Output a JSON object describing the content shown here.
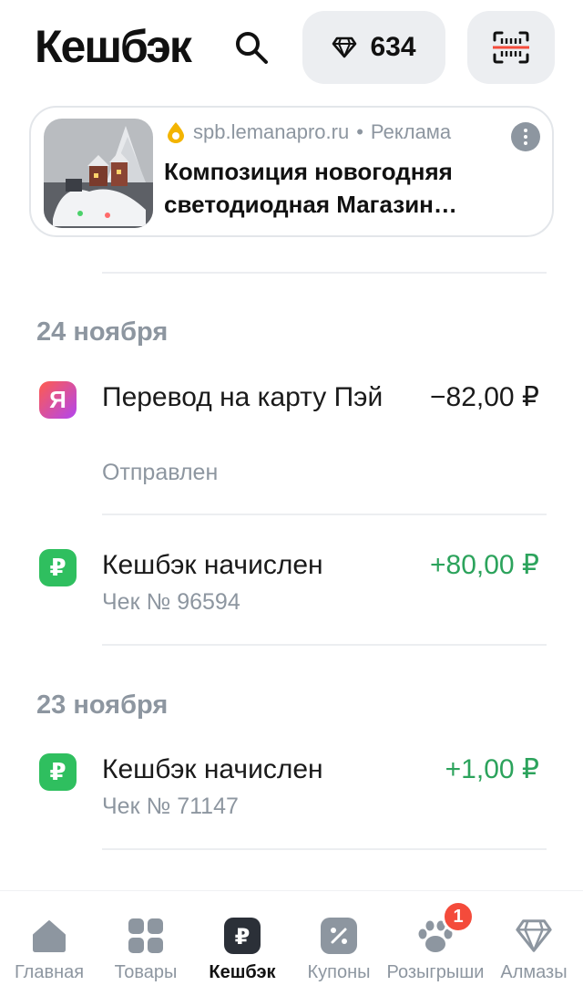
{
  "header": {
    "title": "Кешбэк",
    "diamonds_count": "634"
  },
  "ad": {
    "source": "spb.lemanapro.ru",
    "separator": "•",
    "label": "Реклама",
    "title": "Композиция новогодняя светодиодная Магазин…"
  },
  "groups": [
    {
      "date": "24 ноября",
      "transactions": [
        {
          "icon": "yandex-pay-icon",
          "icon_glyph": "Я",
          "title": "Перевод на карту Пэй",
          "subtitle": "Отправлен",
          "amount": "−82,00 ₽",
          "kind": "negative"
        },
        {
          "icon": "ruble-cashback-icon",
          "icon_glyph": "₽",
          "title": "Кешбэк начислен",
          "subtitle": "Чек № 96594",
          "amount": "+80,00 ₽",
          "kind": "positive"
        }
      ]
    },
    {
      "date": "23 ноября",
      "transactions": [
        {
          "icon": "ruble-cashback-icon",
          "icon_glyph": "₽",
          "title": "Кешбэк начислен",
          "subtitle": "Чек № 71147",
          "amount": "+1,00 ₽",
          "kind": "positive"
        }
      ]
    }
  ],
  "nav": {
    "items": [
      {
        "label": "Главная",
        "icon": "home-icon"
      },
      {
        "label": "Товары",
        "icon": "grid-icon"
      },
      {
        "label": "Кешбэк",
        "icon": "ruble-icon",
        "active": true
      },
      {
        "label": "Купоны",
        "icon": "percent-icon"
      },
      {
        "label": "Розыгрыши",
        "icon": "paw-icon",
        "badge": "1"
      },
      {
        "label": "Алмазы",
        "icon": "diamond-icon"
      }
    ]
  },
  "colors": {
    "positive": "#2ca35c",
    "muted": "#8d96a0",
    "badge": "#f44b3b"
  }
}
